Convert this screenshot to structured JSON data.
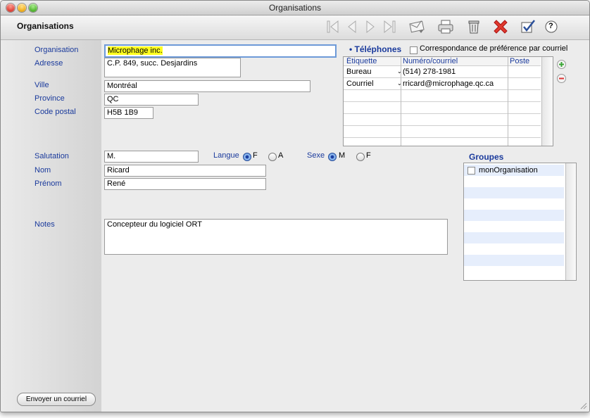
{
  "window": {
    "title": "Organisations"
  },
  "toolbar": {
    "section_title": "Organisations",
    "buttons": [
      "first-record",
      "previous-record",
      "next-record",
      "last-record",
      "send-email",
      "print",
      "delete",
      "cancel",
      "save",
      "help"
    ],
    "help_label": "?"
  },
  "form": {
    "organisation": {
      "label": "Organisation",
      "value": "Microphage inc."
    },
    "adresse": {
      "label": "Adresse",
      "value": "C.P. 849, succ. Desjardins"
    },
    "ville": {
      "label": "Ville",
      "value": "Montréal"
    },
    "province": {
      "label": "Province",
      "value": "QC"
    },
    "code_postal": {
      "label": "Code postal",
      "value": "H5B 1B9"
    },
    "salutation": {
      "label": "Salutation",
      "value": "M."
    },
    "nom": {
      "label": "Nom",
      "value": "Ricard"
    },
    "prenom": {
      "label": "Prénom",
      "value": "René"
    },
    "notes": {
      "label": "Notes",
      "value": "Concepteur du logiciel ORT"
    }
  },
  "langue": {
    "label": "Langue",
    "options": [
      "F",
      "A"
    ],
    "selected": "F"
  },
  "sexe": {
    "label": "Sexe",
    "options": [
      "M",
      "F"
    ],
    "selected": "M"
  },
  "telephones": {
    "title": "• Téléphones",
    "pref_label": "Correspondance de préférence par courriel",
    "columns": [
      "Étiquette",
      "Numéro/courriel",
      "Poste"
    ],
    "rows": [
      {
        "etiquette": "Bureau",
        "numero": "(514) 278-1981",
        "poste": ""
      },
      {
        "etiquette": "Courriel",
        "numero": "rricard@microphage.qc.ca",
        "poste": ""
      }
    ]
  },
  "groupes": {
    "title": "Groupes",
    "items": [
      {
        "label": "monOrganisation",
        "checked": false
      }
    ]
  },
  "send_email_button": "Envoyer un courriel",
  "colors": {
    "label_blue": "#1a3a9c",
    "highlight": "#ffff1f",
    "row_stripe": "#e6eefc"
  }
}
